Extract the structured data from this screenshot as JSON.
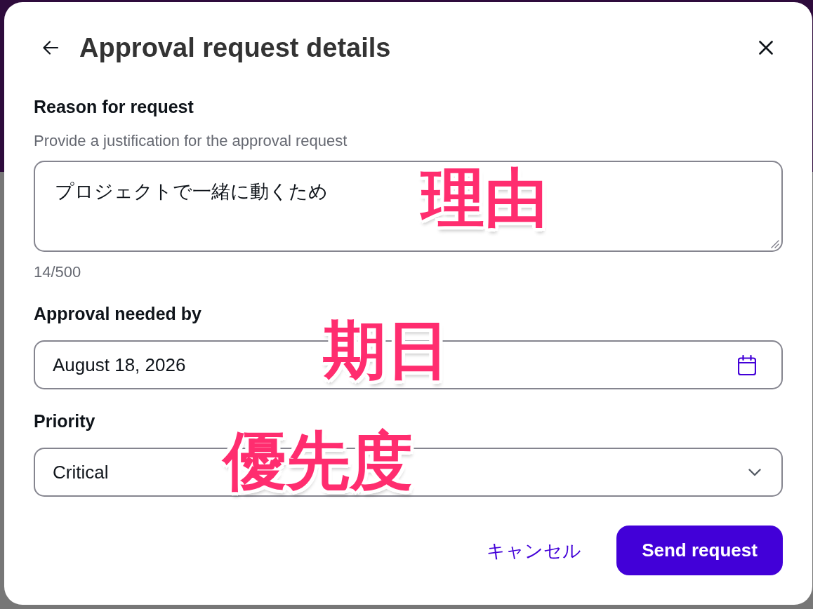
{
  "dialog": {
    "title": "Approval request details",
    "fields": [
      {
        "kind": "textarea",
        "label": "Reason for request",
        "description": "Provide a justification for the approval request",
        "value": "プロジェクトで一緒に動くため",
        "counter": "14/500",
        "annotation": "理由"
      },
      {
        "kind": "date",
        "label": "Approval needed by",
        "value": "August 18, 2026",
        "annotation": "期日"
      },
      {
        "kind": "select",
        "label": "Priority",
        "value": "Critical",
        "annotation": "優先度"
      }
    ],
    "buttons": [
      {
        "kind": "link",
        "label": "キャンセル"
      },
      {
        "kind": "primary",
        "label": "Send request"
      }
    ]
  }
}
